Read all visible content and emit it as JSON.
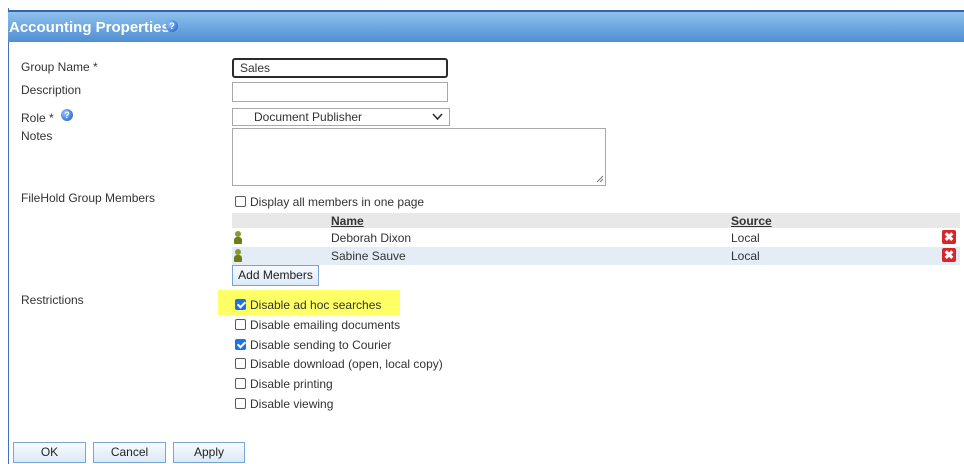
{
  "panel": {
    "title": "Accounting Properties",
    "help_glyph": "?"
  },
  "form": {
    "group_name": {
      "label": "Group Name *",
      "value": "Sales"
    },
    "description": {
      "label": "Description",
      "value": ""
    },
    "role": {
      "label": "Role *",
      "value": "Document Publisher",
      "help_glyph": "?"
    },
    "notes": {
      "label": "Notes",
      "value": ""
    }
  },
  "members": {
    "label": "FileHold Group Members",
    "display_all_label": "Display all members in one page",
    "display_all_checked": false,
    "columns": {
      "name": "Name",
      "source": "Source"
    },
    "rows": [
      {
        "name": "Deborah Dixon",
        "source": "Local"
      },
      {
        "name": "Sabine Sauve",
        "source": "Local"
      }
    ],
    "add_button": "Add Members",
    "delete_glyph": "✖"
  },
  "restrictions": {
    "label": "Restrictions",
    "items": [
      {
        "label": "Disable ad hoc searches",
        "checked": true
      },
      {
        "label": "Disable emailing documents",
        "checked": false
      },
      {
        "label": "Disable sending to Courier",
        "checked": true
      },
      {
        "label": "Disable download (open, local copy)",
        "checked": false
      },
      {
        "label": "Disable printing",
        "checked": false
      },
      {
        "label": "Disable viewing",
        "checked": false
      }
    ],
    "highlight_color": "#ffff66"
  },
  "buttons": {
    "ok": "OK",
    "cancel": "Cancel",
    "apply": "Apply"
  },
  "colors": {
    "title_bar": "#4f8fd2",
    "accent_border": "#3f73b8",
    "delete": "#d7262a",
    "checkbox": "#1a73e8"
  }
}
